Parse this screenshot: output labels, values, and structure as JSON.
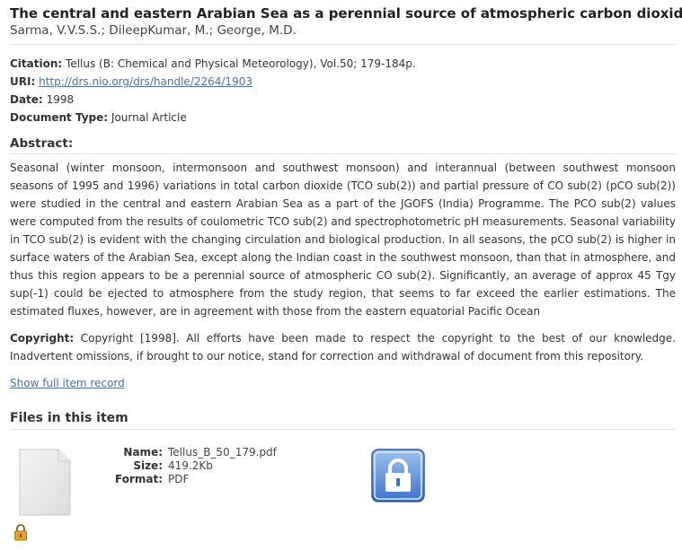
{
  "item": {
    "title": "The central and eastern Arabian Sea as a perennial source of atmospheric carbon dioxide",
    "authors": "Sarma, V.V.S.S.; DileepKumar, M.; George, M.D."
  },
  "metadata": {
    "citation_label": "Citation:",
    "citation_value": "Tellus (B: Chemical and Physical Meteorology), Vol.50; 179-184p.",
    "uri_label": "URI:",
    "uri_value": "http://drs.nio.org/drs/handle/2264/1903",
    "date_label": "Date:",
    "date_value": "1998",
    "doctype_label": "Document Type:",
    "doctype_value": "Journal Article"
  },
  "abstract": {
    "heading": "Abstract:",
    "text": "Seasonal (winter monsoon, intermonsoon and southwest monsoon) and interannual (between southwest monsoon seasons of 1995 and 1996) variations in total carbon dioxide (TCO sub(2)) and partial pressure of CO sub(2) (pCO sub(2)) were studied in the central and eastern Arabian Sea as a part of the JGOFS (India) Programme. The PCO sub(2) values were computed from the results of coulometric TCO sub(2) and spectrophotometric pH measurements. Seasonal variability in TCO sub(2) is evident with the changing circulation and biological production. In all seasons, the pCO sub(2) is higher in surface waters of the Arabian Sea, except along the Indian coast in the southwest monsoon, than that in atmosphere, and thus this region appears to be a perennial source of atmospheric CO sub(2). Significantly, an average of approx 45 Tgy sup(-1) could be ejected to atmosphere from the study region, that seems to far exceed the earlier estimations. The estimated fluxes, however, are in agreement with those from the eastern equatorial Pacific Ocean"
  },
  "copyright": {
    "label": "Copyright:",
    "text": "Copyright [1998]. All efforts have been made to respect the copyright to the best of our knowledge. Inadvertent omissions, if brought to our notice, stand for correction and withdrawal of document from this repository."
  },
  "links": {
    "full_record": "Show full item record"
  },
  "files": {
    "heading": "Files in this item",
    "name_label": "Name:",
    "name_value": "Tellus_B_50_179.pdf",
    "size_label": "Size:",
    "size_value": "419.2Kb",
    "format_label": "Format:",
    "format_value": "PDF",
    "icons": [
      "document-thumbnail-icon",
      "restricted-lock-icon",
      "access-lock-icon"
    ]
  }
}
